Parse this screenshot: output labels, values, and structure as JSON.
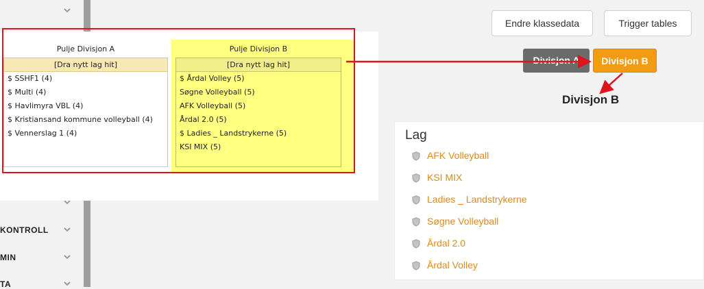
{
  "sidebar": {
    "items": [
      {
        "label": ""
      },
      {
        "label": ""
      },
      {
        "label": "KONTROLL"
      },
      {
        "label": "MIN"
      },
      {
        "label": "TA"
      }
    ]
  },
  "divisions": {
    "a": {
      "title": "Pulje Divisjon A",
      "dropzone": "[Dra nytt lag hit]",
      "teams": [
        "$ SSHF1 (4)",
        "$ Multi (4)",
        "$ Havlimyra VBL (4)",
        "$ Kristiansand kommune volleyball (4)",
        "$ Vennerslag 1 (4)"
      ]
    },
    "b": {
      "title": "Pulje Divisjon B",
      "dropzone": "[Dra nytt lag hit]",
      "teams": [
        "$ Årdal Volley (5)",
        "Søgne Volleyball (5)",
        "AFK Volleyball (5)",
        "Årdal 2.0 (5)",
        "$ Ladies _ Landstrykerne (5)",
        "KSI MIX (5)"
      ]
    }
  },
  "toolbar": {
    "edit_label": "Endre klassedata",
    "trigger_label": "Trigger tables"
  },
  "tabs": [
    {
      "label": "Divisjon A",
      "active": false
    },
    {
      "label": "Divisjon B",
      "active": true
    }
  ],
  "selected_division_heading": "Divisjon B",
  "lag": {
    "title": "Lag",
    "items": [
      "AFK Volleyball",
      "KSI MIX",
      "Ladies _ Landstrykerne",
      "Søgne Volleyball",
      "Årdal 2.0",
      "Årdal Volley"
    ]
  },
  "colors": {
    "accent": "#f39c12",
    "link": "#e08a14",
    "highlight": "#ffff80",
    "annotation": "#e0141c"
  }
}
